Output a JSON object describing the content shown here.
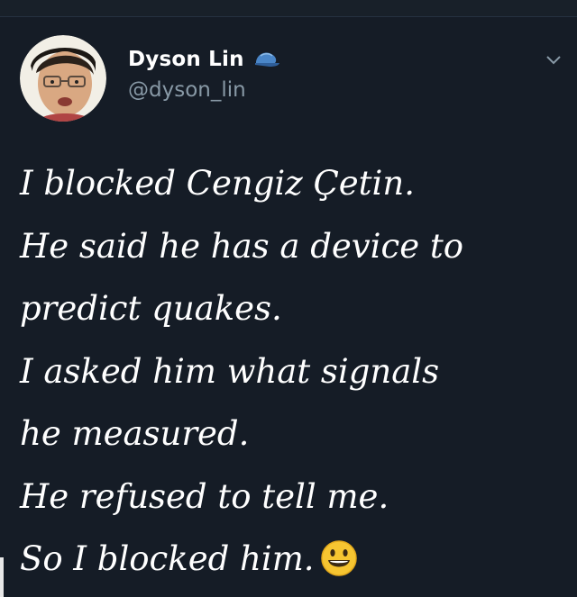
{
  "tweet": {
    "author": {
      "display_name": "Dyson Lin",
      "handle": "@dyson_lin",
      "badge_icon": "cap-icon",
      "avatar_icon": "avatar"
    },
    "menu_icon": "chevron-down-icon",
    "lines": [
      "I blocked Cengiz Çetin.",
      "He said he has a device to",
      "predict quakes.",
      "I asked him what signals",
      "he measured.",
      "He refused to tell me.",
      "So I blocked him."
    ],
    "trailing_emoji": "grinning-face-emoji"
  },
  "colors": {
    "background": "#151c26",
    "text": "#ffffff",
    "handle": "#8899a6",
    "cap": "#4a86c8"
  }
}
